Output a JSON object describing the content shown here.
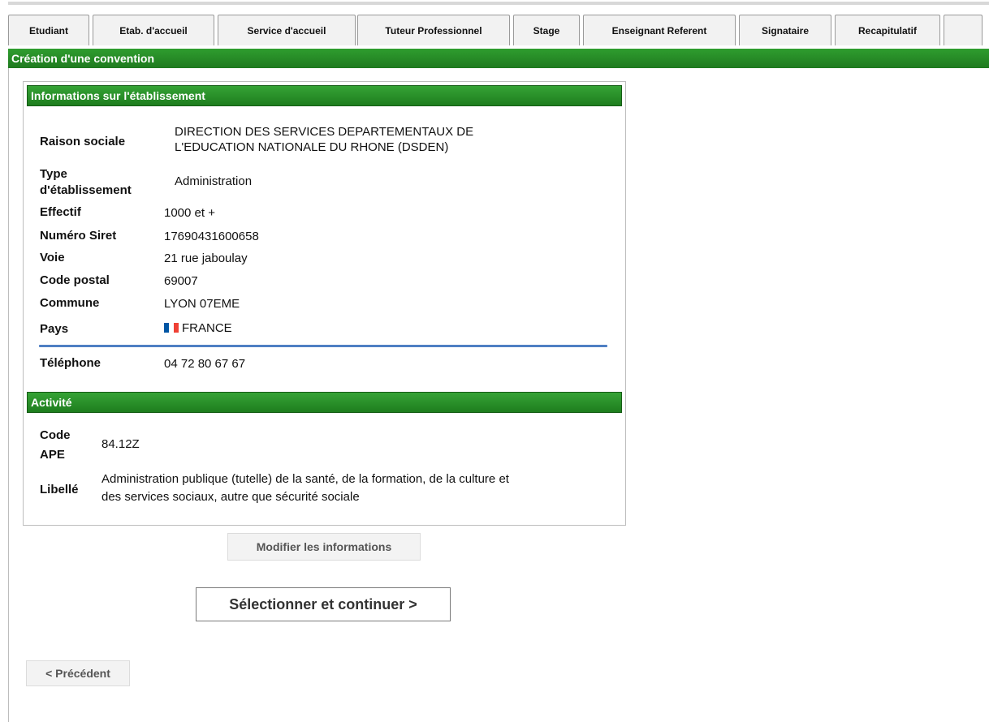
{
  "tabs": [
    {
      "label": "Etudiant"
    },
    {
      "label": "Etab. d'accueil"
    },
    {
      "label": "Service d'accueil"
    },
    {
      "label": "Tuteur Professionnel"
    },
    {
      "label": "Stage"
    },
    {
      "label": "Enseignant Referent"
    },
    {
      "label": "Signataire"
    },
    {
      "label": "Recapitulatif"
    },
    {
      "label": ""
    }
  ],
  "page_title": "Création d'une convention",
  "etablissement": {
    "heading": "Informations sur l'établissement",
    "raison_sociale": {
      "label": "Raison sociale",
      "line1": "DIRECTION DES SERVICES DEPARTEMENTAUX DE",
      "line2": "L'EDUCATION NATIONALE DU RHONE (DSDEN)"
    },
    "type": {
      "label1": "Type",
      "label2": "d'établissement",
      "value": "Administration"
    },
    "effectif": {
      "label": "Effectif",
      "value": "1000 et +"
    },
    "siret": {
      "label": "Numéro Siret",
      "value": "17690431600658"
    },
    "voie": {
      "label": "Voie",
      "value": "21 rue jaboulay"
    },
    "code_postal": {
      "label": "Code postal",
      "value": "69007"
    },
    "commune": {
      "label": "Commune",
      "value": "LYON 07EME"
    },
    "pays": {
      "label": "Pays",
      "value": "FRANCE",
      "flag_colors": [
        "#0055a4",
        "#ffffff",
        "#ef4135"
      ]
    },
    "telephone": {
      "label": "Téléphone",
      "value": "04 72 80 67 67"
    }
  },
  "activite": {
    "heading": "Activité",
    "code_ape": {
      "label1": "Code",
      "label2": "APE",
      "value": "84.12Z"
    },
    "libelle": {
      "label": "Libellé",
      "line1": "Administration publique (tutelle) de la santé, de la formation, de la culture et",
      "line2": "des services sociaux, autre que sécurité sociale"
    }
  },
  "buttons": {
    "modifier": "Modifier les informations",
    "selectionner": "Sélectionner et continuer >",
    "precedent": "< Précédent"
  },
  "colors": {
    "header_green": "#1f7a1f",
    "rule_blue": "#4f7fc3"
  }
}
